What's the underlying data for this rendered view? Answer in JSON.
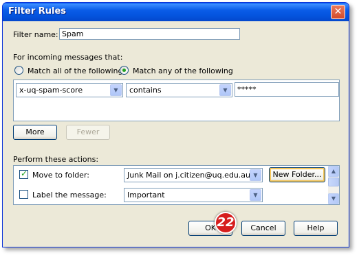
{
  "window": {
    "title": "Filter Rules"
  },
  "filter_name": {
    "label": "Filter name:",
    "value": "Spam"
  },
  "incoming": {
    "label": "For incoming messages that:",
    "match_all": "Match all of the following",
    "match_any": "Match any of the following",
    "selected": "any"
  },
  "rule": {
    "field": "x-uq-spam-score",
    "operator": "contains",
    "value": "*****"
  },
  "rule_buttons": {
    "more": "More",
    "fewer": "Fewer"
  },
  "actions": {
    "label": "Perform these actions:",
    "rows": [
      {
        "label": "Move to folder:",
        "checked": true,
        "value": "Junk Mail on j.citizen@uq.edu.au"
      },
      {
        "label": "Label the message:",
        "checked": false,
        "value": "Important"
      }
    ],
    "new_folder": "New Folder..."
  },
  "footer": {
    "ok": "OK",
    "cancel": "Cancel",
    "help": "Help"
  },
  "badge": {
    "number": "22"
  }
}
